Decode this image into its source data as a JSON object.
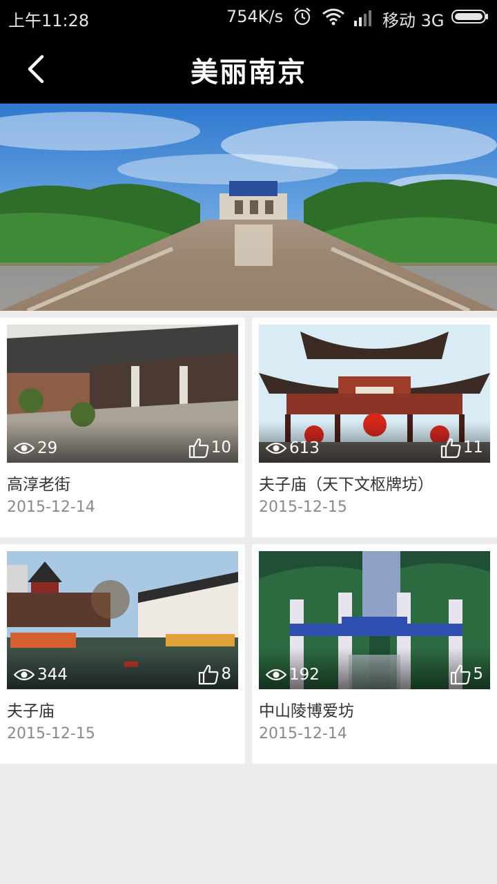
{
  "status_bar": {
    "time": "上午11:28",
    "speed": "754K/s",
    "carrier": "移动 3G",
    "icons": [
      "alarm-icon",
      "wifi-icon",
      "signal-icon",
      "battery-icon"
    ]
  },
  "header": {
    "title": "美丽南京",
    "back_icon": "chevron-left-icon"
  },
  "banner": {
    "subject": "中山陵",
    "image": "landscape-photo"
  },
  "cards": [
    {
      "name": "高淳老街",
      "date": "2015-12-14",
      "views": "29",
      "likes": "10"
    },
    {
      "name": "夫子庙（天下文枢牌坊）",
      "date": "2015-12-15",
      "views": "613",
      "likes": "11"
    },
    {
      "name": "夫子庙",
      "date": "2015-12-15",
      "views": "344",
      "likes": "8"
    },
    {
      "name": "中山陵博爱坊",
      "date": "2015-12-14",
      "views": "192",
      "likes": "5"
    }
  ],
  "colors": {
    "header_bg": "#000000",
    "page_bg": "#ececec",
    "card_bg": "#ffffff",
    "title_text": "#333333",
    "date_text": "#8a8a8a"
  }
}
